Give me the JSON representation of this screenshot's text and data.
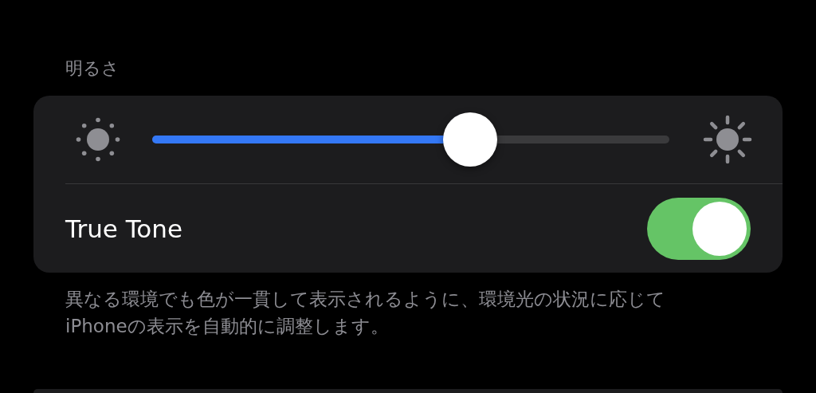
{
  "section_header": "明るさ",
  "brightness": {
    "level": 0.615
  },
  "true_tone": {
    "label": "True Tone",
    "on": true
  },
  "footer": "異なる環境でも色が一貫して表示されるように、環境光の状況に応じてiPhoneの表示を自動的に調整します。"
}
